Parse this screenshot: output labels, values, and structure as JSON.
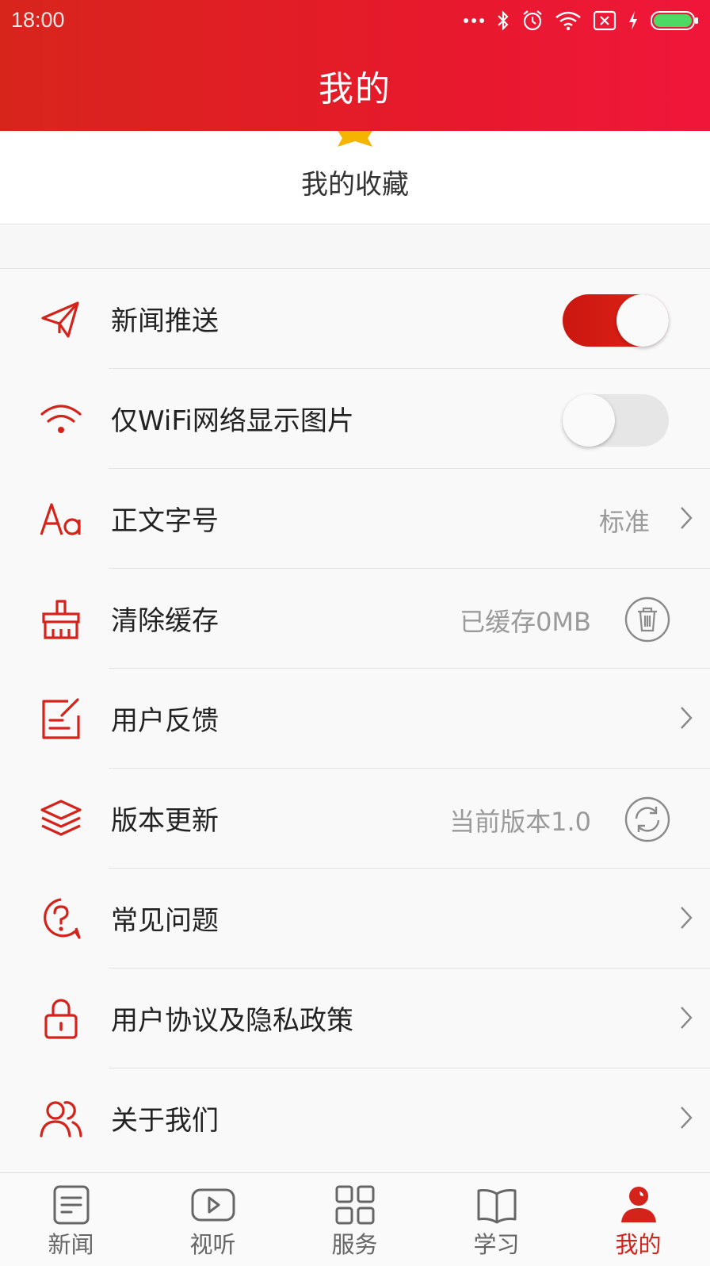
{
  "status_bar": {
    "time": "18:00",
    "icons": [
      "more-dots-icon",
      "bluetooth-icon",
      "alarm-icon",
      "wifi-icon",
      "sim-off-icon",
      "charging-icon",
      "battery-icon"
    ]
  },
  "header": {
    "title": "我的"
  },
  "favorites": {
    "label": "我的收藏",
    "icon": "star-icon"
  },
  "settings": {
    "push": {
      "label": "新闻推送",
      "icon": "send-icon",
      "toggle_on": true
    },
    "wifi": {
      "label": "仅WiFi网络显示图片",
      "icon": "wifi-icon",
      "toggle_on": false
    },
    "fontsize": {
      "label": "正文字号",
      "icon": "font-size-icon",
      "value": "标准"
    },
    "cache": {
      "label": "清除缓存",
      "icon": "broom-icon",
      "value": "已缓存0MB"
    },
    "feedback": {
      "label": "用户反馈",
      "icon": "edit-icon"
    },
    "update": {
      "label": "版本更新",
      "icon": "layers-icon",
      "value": "当前版本1.0"
    },
    "faq": {
      "label": "常见问题",
      "icon": "question-icon"
    },
    "privacy": {
      "label": "用户协议及隐私政策",
      "icon": "lock-icon"
    },
    "about": {
      "label": "关于我们",
      "icon": "users-icon"
    }
  },
  "tabbar": {
    "tabs": [
      {
        "label": "新闻",
        "icon": "news-icon",
        "active": false
      },
      {
        "label": "视听",
        "icon": "video-icon",
        "active": false
      },
      {
        "label": "服务",
        "icon": "grid-icon",
        "active": false
      },
      {
        "label": "学习",
        "icon": "book-icon",
        "active": false
      },
      {
        "label": "我的",
        "icon": "profile-icon",
        "active": true
      }
    ]
  },
  "colors": {
    "accent": "#d4231b",
    "header_start": "#d8251c",
    "header_end": "#f0163a",
    "star": "#f5b400",
    "inactive_icon": "#666666",
    "value_text": "#9a9a9a"
  }
}
